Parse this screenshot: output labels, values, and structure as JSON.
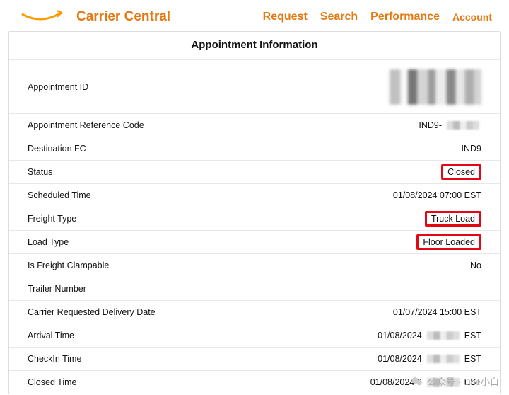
{
  "header": {
    "brand": "Carrier Central",
    "nav": {
      "request": "Request",
      "search": "Search",
      "performance": "Performance",
      "account": "Account"
    }
  },
  "panel": {
    "title": "Appointment Information",
    "rows": {
      "appointment_id": {
        "label": "Appointment ID",
        "value": ""
      },
      "appointment_ref": {
        "label": "Appointment Reference Code",
        "prefix": "IND9-"
      },
      "destination_fc": {
        "label": "Destination FC",
        "value": "IND9"
      },
      "status": {
        "label": "Status",
        "value": "Closed"
      },
      "scheduled_time": {
        "label": "Scheduled Time",
        "value": "01/08/2024 07:00 EST"
      },
      "freight_type": {
        "label": "Freight Type",
        "value": "Truck Load"
      },
      "load_type": {
        "label": "Load Type",
        "value": "Floor Loaded"
      },
      "is_clampable": {
        "label": "Is Freight Clampable",
        "value": "No"
      },
      "trailer_number": {
        "label": "Trailer Number",
        "value": ""
      },
      "carrier_req_date": {
        "label": "Carrier Requested Delivery Date",
        "value": "01/07/2024 15:00 EST"
      },
      "arrival_time": {
        "label": "Arrival Time",
        "date": "01/08/2024 ",
        "tz": "EST"
      },
      "checkin_time": {
        "label": "CheckIn Time",
        "date": "01/08/2024 ",
        "tz": "EST"
      },
      "closed_time": {
        "label": "Closed Time",
        "date": "01/08/2024 0",
        "tz": "EST"
      }
    }
  },
  "watermark": {
    "text": "公众号 · One小白"
  }
}
